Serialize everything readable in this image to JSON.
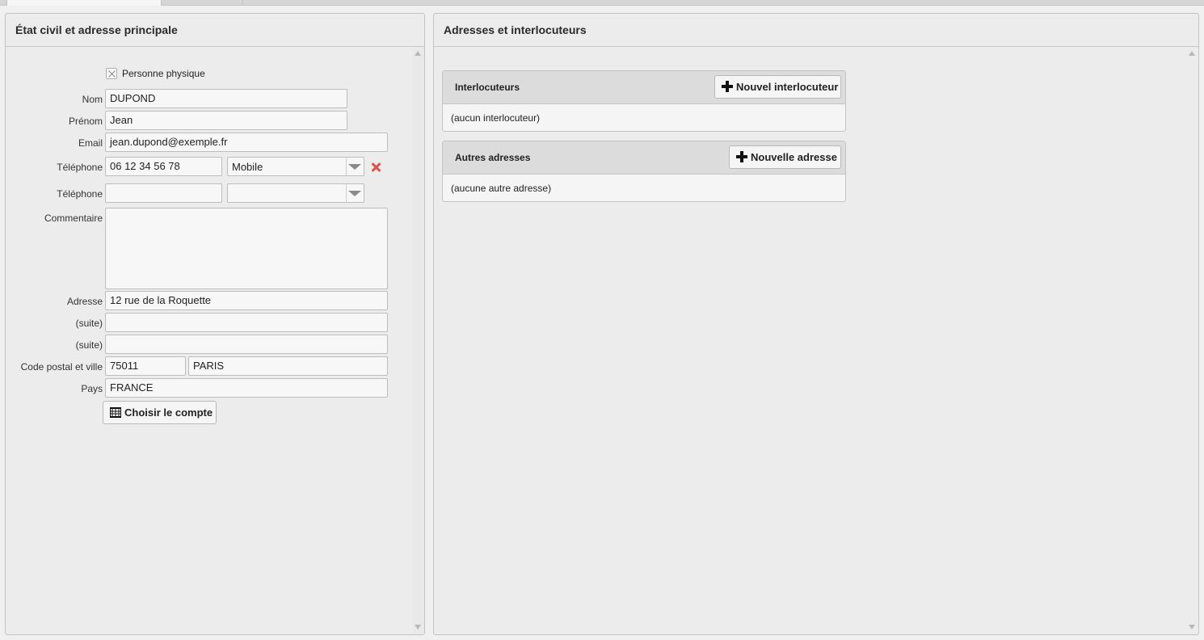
{
  "left_panel": {
    "title": "État civil et adresse principale",
    "person_checkbox_label": "Personne physique",
    "labels": {
      "nom": "Nom",
      "prenom": "Prénom",
      "email": "Email",
      "telephone1": "Téléphone",
      "telephone2": "Téléphone",
      "commentaire": "Commentaire",
      "adresse": "Adresse",
      "suite1": "(suite)",
      "suite2": "(suite)",
      "cp_ville": "Code postal et ville",
      "pays": "Pays"
    },
    "values": {
      "nom": "DUPOND",
      "prenom": "Jean",
      "email": "jean.dupond@exemple.fr",
      "telephone1": "06 12 34 56 78",
      "telephone1_type": "Mobile",
      "telephone2": "",
      "telephone2_type": "",
      "commentaire": "",
      "adresse": "12 rue de la Roquette",
      "suite1": "",
      "suite2": "",
      "code_postal": "75011",
      "ville": "PARIS",
      "pays": "FRANCE"
    },
    "choose_account_label": "Choisir le compte"
  },
  "right_panel": {
    "title": "Adresses et interlocuteurs",
    "interlocuteurs": {
      "title": "Interlocuteurs",
      "add_label": "Nouvel interlocuteur",
      "empty_text": "(aucun interlocuteur)"
    },
    "autres_adresses": {
      "title": "Autres adresses",
      "add_label": "Nouvelle adresse",
      "empty_text": "(aucune autre adresse)"
    }
  },
  "icons": {
    "add": "plus-icon",
    "delete": "delete-icon",
    "account": "ledger-icon",
    "checkbox": "checkbox-unchecked"
  },
  "colors": {
    "delete_red": "#d9534f",
    "panel_bg": "#ececec",
    "subpanel_header": "#dcdcdc"
  }
}
